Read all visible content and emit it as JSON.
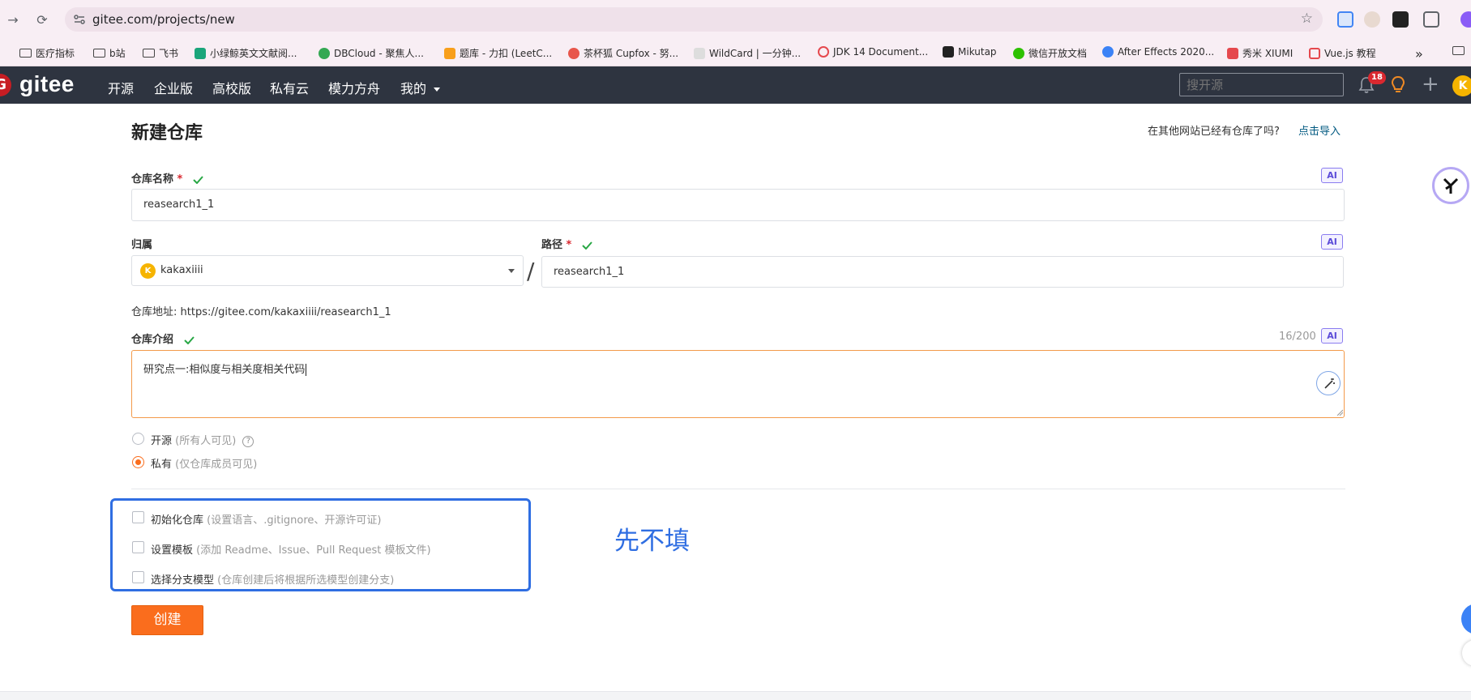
{
  "browser": {
    "url": "gitee.com/projects/new",
    "bookmarks": [
      {
        "label": "医疗指标",
        "icon": "folder-icon"
      },
      {
        "label": "b站",
        "icon": "folder-icon"
      },
      {
        "label": "飞书",
        "icon": "folder-icon"
      },
      {
        "label": "小绿鲸英文文献阅...",
        "icon": "whale-icon",
        "color": "#1aa57a"
      },
      {
        "label": "DBCloud - 聚焦人...",
        "icon": "dbcloud-icon",
        "color": "#34a853"
      },
      {
        "label": "题库 - 力扣 (LeetC...",
        "icon": "leetcode-icon",
        "color": "#f89f1b"
      },
      {
        "label": "茶杯狐 Cupfox - 努...",
        "icon": "cupfox-icon",
        "color": "#e8564b"
      },
      {
        "label": "WildCard | 一分钟...",
        "icon": "wildcard-icon",
        "color": "#333333"
      },
      {
        "label": "JDK 14 Document...",
        "icon": "oracle-icon",
        "color": "#e5484d"
      },
      {
        "label": "Mikutap",
        "icon": "mikutap-icon",
        "color": "#222222"
      },
      {
        "label": "微信开放文档",
        "icon": "wechat-icon",
        "color": "#2dc100"
      },
      {
        "label": "After Effects 2020...",
        "icon": "ae-icon",
        "color": "#3b82f6"
      },
      {
        "label": "秀米 XIUMI",
        "icon": "xiumi-icon",
        "color": "#e5484d"
      },
      {
        "label": "Vue.js 教程",
        "icon": "vue-icon",
        "color": "#e5484d"
      }
    ],
    "more": "»"
  },
  "header": {
    "logo_text": "gitee",
    "logo_g": "G",
    "nav": [
      "开源",
      "企业版",
      "高校版",
      "私有云",
      "模力方舟",
      "我的"
    ],
    "search_placeholder": "搜开源",
    "notification_count": "18",
    "avatar_letter": "K",
    "accent": "#c71d23"
  },
  "form": {
    "title": "新建仓库",
    "import_question": "在其他网站已经有仓库了吗?",
    "import_link": "点击导入",
    "ai_badge": "AI",
    "name_label": "仓库名称",
    "required_mark": "*",
    "name_value": "reasearch1_1",
    "owner_label": "归属",
    "owner_avatar": "K",
    "owner_value": "kakaxiiii",
    "slash": "/",
    "path_label": "路径",
    "path_value": "reasearch1_1",
    "address_label": "仓库地址:",
    "address_value": "https://gitee.com/kakaxiiii/reasearch1_1",
    "intro_label": "仓库介绍",
    "intro_count": "16/200",
    "intro_value": "研究点一:相似度与相关度相关代码",
    "visibility": [
      {
        "label": "开源",
        "hint": "(所有人可见)",
        "selected": false
      },
      {
        "label": "私有",
        "hint": "(仅仓库成员可见)",
        "selected": true
      }
    ],
    "help_mark": "?",
    "options": [
      {
        "label": "初始化仓库",
        "hint": "(设置语言、.gitignore、开源许可证)"
      },
      {
        "label": "设置模板",
        "hint": "(添加 Readme、Issue、Pull Request 模板文件)"
      },
      {
        "label": "选择分支模型",
        "hint": "(仓库创建后将根据所选模型创建分支)"
      }
    ],
    "annotation": "先不填",
    "submit_label": "创建",
    "primary_color": "#fa6d1d"
  }
}
